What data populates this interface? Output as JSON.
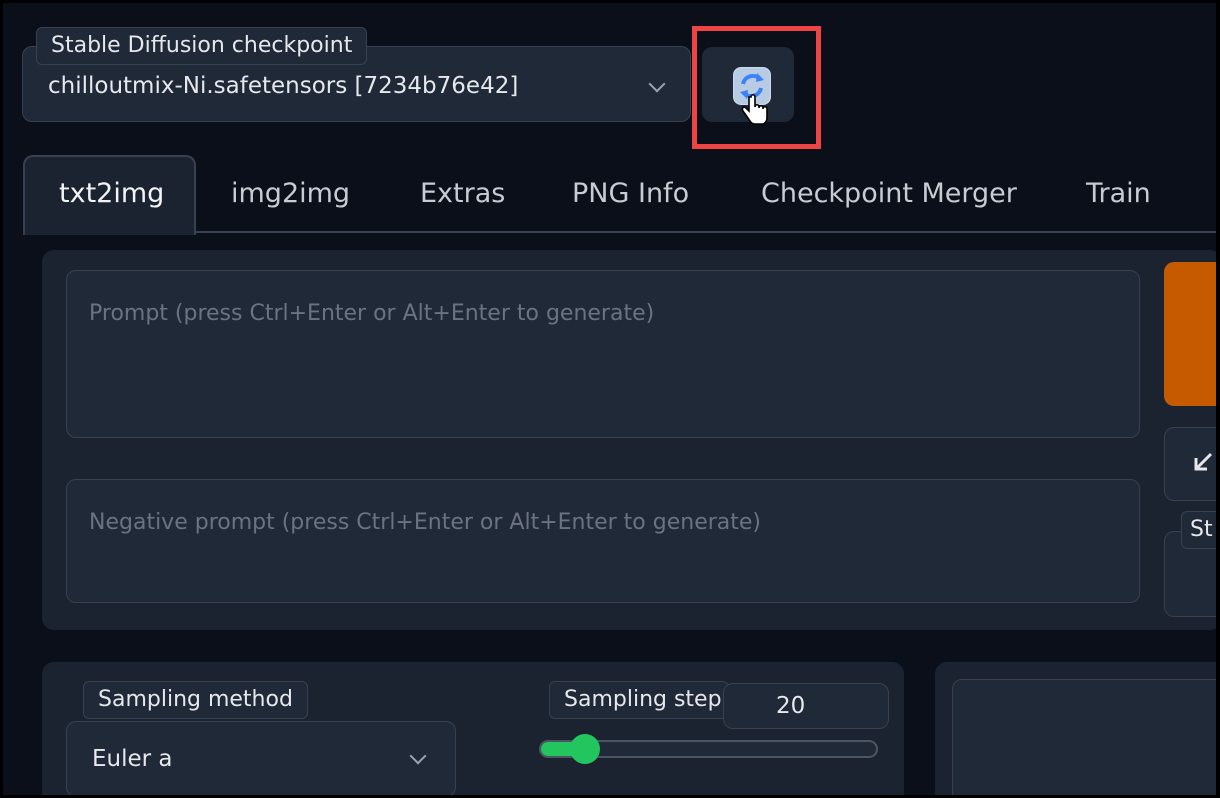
{
  "checkpoint": {
    "label": "Stable Diffusion checkpoint",
    "value": "chilloutmix-Ni.safetensors [7234b76e42]",
    "refresh_icon": "refresh-icon",
    "highlight_color": "#ef4444"
  },
  "tabs": [
    {
      "label": "txt2img",
      "active": true
    },
    {
      "label": "img2img"
    },
    {
      "label": "Extras"
    },
    {
      "label": "PNG Info"
    },
    {
      "label": "Checkpoint Merger"
    },
    {
      "label": "Train"
    }
  ],
  "prompt": {
    "placeholder": "Prompt (press Ctrl+Enter or Alt+Enter to generate)",
    "negative_placeholder": "Negative prompt (press Ctrl+Enter or Alt+Enter to generate)"
  },
  "side": {
    "generate_color": "#c65a00",
    "arrow_icon": "arrow-down-left-icon",
    "styles_label_partial": "St"
  },
  "sampling": {
    "method_label": "Sampling method",
    "method_value": "Euler a",
    "steps_label": "Sampling step",
    "steps_value": "20",
    "steps_fraction": 0.13,
    "accent": "#22c55e"
  }
}
